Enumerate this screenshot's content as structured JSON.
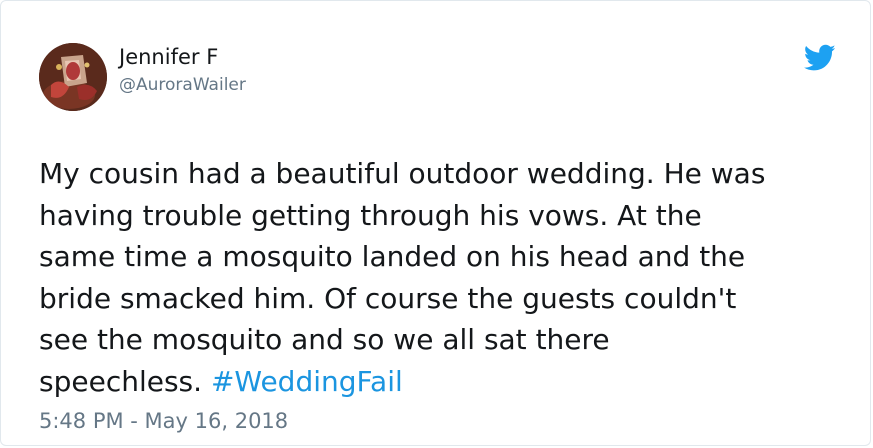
{
  "author": {
    "name": "Jennifer F",
    "handle": "@AuroraWailer",
    "avatar_icon": "profile-photo"
  },
  "brand": {
    "icon": "twitter-bird-icon",
    "color": "#1da1f2"
  },
  "tweet": {
    "text": "My cousin had a beautiful outdoor wedding. He was\nhaving trouble getting through his vows. At the\nsame time a mosquito landed on his head and the\nbride smacked him. Of course the guests couldn't\nsee the mosquito and so we all sat there\nspeechless. ",
    "hashtag": "#WeddingFail",
    "hashtag_color": "#1b95e0",
    "timestamp": "5:48 PM - May 16, 2018"
  }
}
